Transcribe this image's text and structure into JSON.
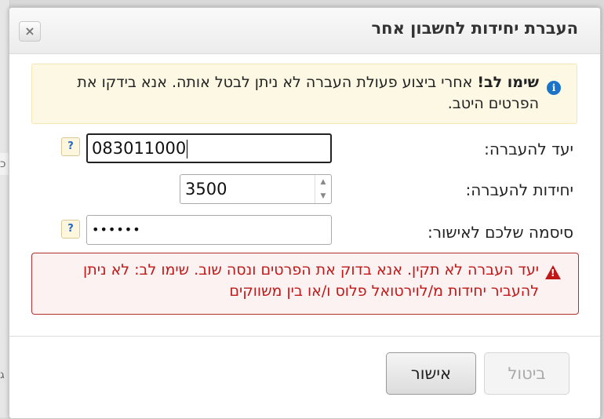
{
  "background": {
    "left_text_1": "כ",
    "left_text_2": "ג"
  },
  "dialog": {
    "title": "העברת יחידות לחשבון אחר",
    "close_label": "×",
    "warning": {
      "bold": "שימו לב!",
      "text": " אחרי ביצוע פעולת העברה לא ניתן לבטל אותה. אנא בידקו את הפרטים היטב.",
      "icon": "info-icon"
    },
    "fields": {
      "destination": {
        "label": "יעד להעברה:",
        "value": "083011000",
        "help": "?"
      },
      "units": {
        "label": "יחידות להעברה:",
        "value": "3500"
      },
      "password": {
        "label": "סיסמה שלכם לאישור:",
        "value": "••••••",
        "help": "?"
      }
    },
    "error": {
      "text": "יעד העברה לא תקין. אנא בדוק את הפרטים ונסה שוב. שימו לב: לא ניתן להעביר יחידות מ/לוירטואל פלוס ו/או בין משווקים",
      "icon": "warning-triangle-icon"
    },
    "buttons": {
      "ok": "אישור",
      "cancel": "ביטול"
    }
  }
}
